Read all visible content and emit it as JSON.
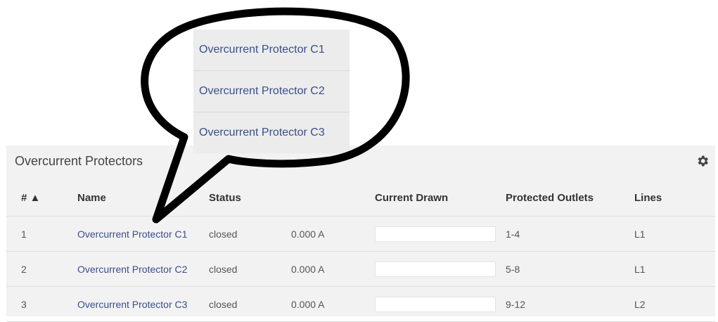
{
  "callout": {
    "items": [
      {
        "label": "Overcurrent Protector C1"
      },
      {
        "label": "Overcurrent Protector C2"
      },
      {
        "label": "Overcurrent Protector C3"
      }
    ]
  },
  "panel": {
    "title": "Overcurrent Protectors",
    "settings_icon": "gear-icon"
  },
  "table": {
    "headers": {
      "num": "# ▲",
      "name": "Name",
      "status": "Status",
      "current_drawn": "Current Drawn",
      "protected_outlets": "Protected Outlets",
      "lines": "Lines"
    },
    "rows": [
      {
        "num": "1",
        "name": "Overcurrent Protector C1",
        "status": "closed",
        "current": "0.000 A",
        "current_fraction": 0,
        "outlets": "1-4",
        "lines": "L1"
      },
      {
        "num": "2",
        "name": "Overcurrent Protector C2",
        "status": "closed",
        "current": "0.000 A",
        "current_fraction": 0,
        "outlets": "5-8",
        "lines": "L1"
      },
      {
        "num": "3",
        "name": "Overcurrent Protector C3",
        "status": "closed",
        "current": "0.000 A",
        "current_fraction": 0,
        "outlets": "9-12",
        "lines": "L2"
      }
    ]
  },
  "colors": {
    "link": "#3a4f8a",
    "panel_bg": "#f2f2f2",
    "callout_fill": "#ececec"
  }
}
